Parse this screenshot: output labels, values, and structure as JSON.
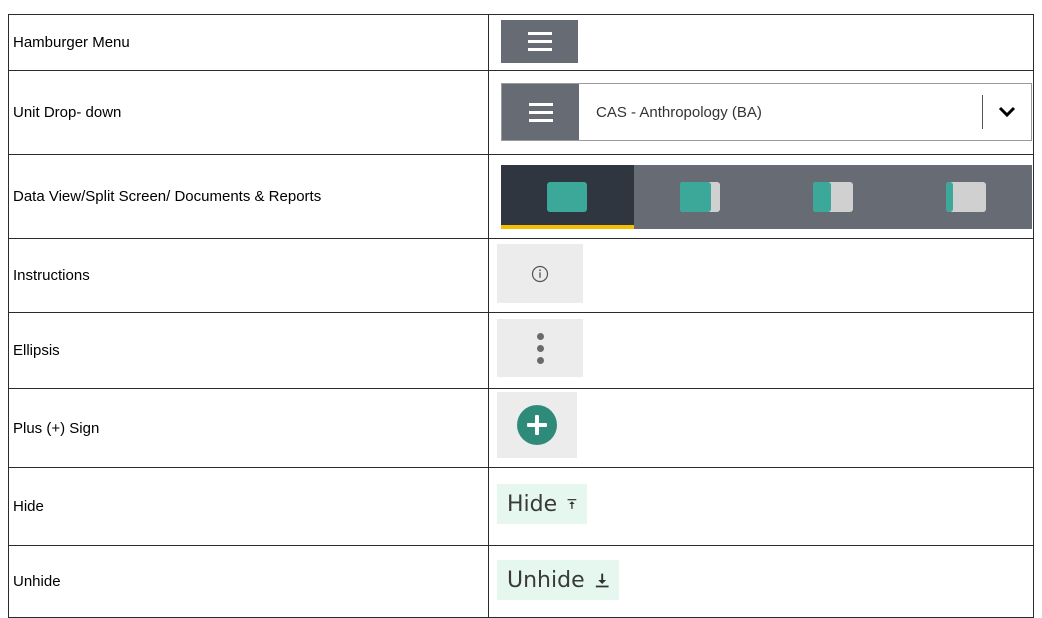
{
  "rows": [
    {
      "label": "Hamburger Menu"
    },
    {
      "label": "Unit Drop- down"
    },
    {
      "label": "Data View/Split Screen/ Documents & Reports"
    },
    {
      "label": "Instructions"
    },
    {
      "label": "Ellipsis"
    },
    {
      "label": "Plus (+) Sign"
    },
    {
      "label": "Hide"
    },
    {
      "label": "Unhide"
    }
  ],
  "unit_dropdown": {
    "selected": "CAS - Anthropology (BA)"
  },
  "hide_button": {
    "label": "Hide"
  },
  "unhide_button": {
    "label": "Unhide"
  },
  "view_switcher": {
    "active_index": 0,
    "options": [
      "data-view",
      "split-screen-left",
      "split-screen-right",
      "documents-reports"
    ]
  },
  "icons": {
    "hamburger": "hamburger-menu-icon",
    "chevron": "chevron-down-icon",
    "info": "info-circle-icon",
    "ellipsis": "vertical-ellipsis-icon",
    "plus": "plus-circle-icon",
    "hide": "arrow-up-to-bar-icon",
    "unhide": "arrow-down-to-bar-icon"
  },
  "colors": {
    "menu_gray": "#676b74",
    "active_dark": "#2f3640",
    "active_underline": "#f6be00",
    "teal": "#3ba89a",
    "plus_teal": "#2e8b79",
    "icon_bg": "#ececec",
    "mint_bg": "#e6f7f0"
  }
}
